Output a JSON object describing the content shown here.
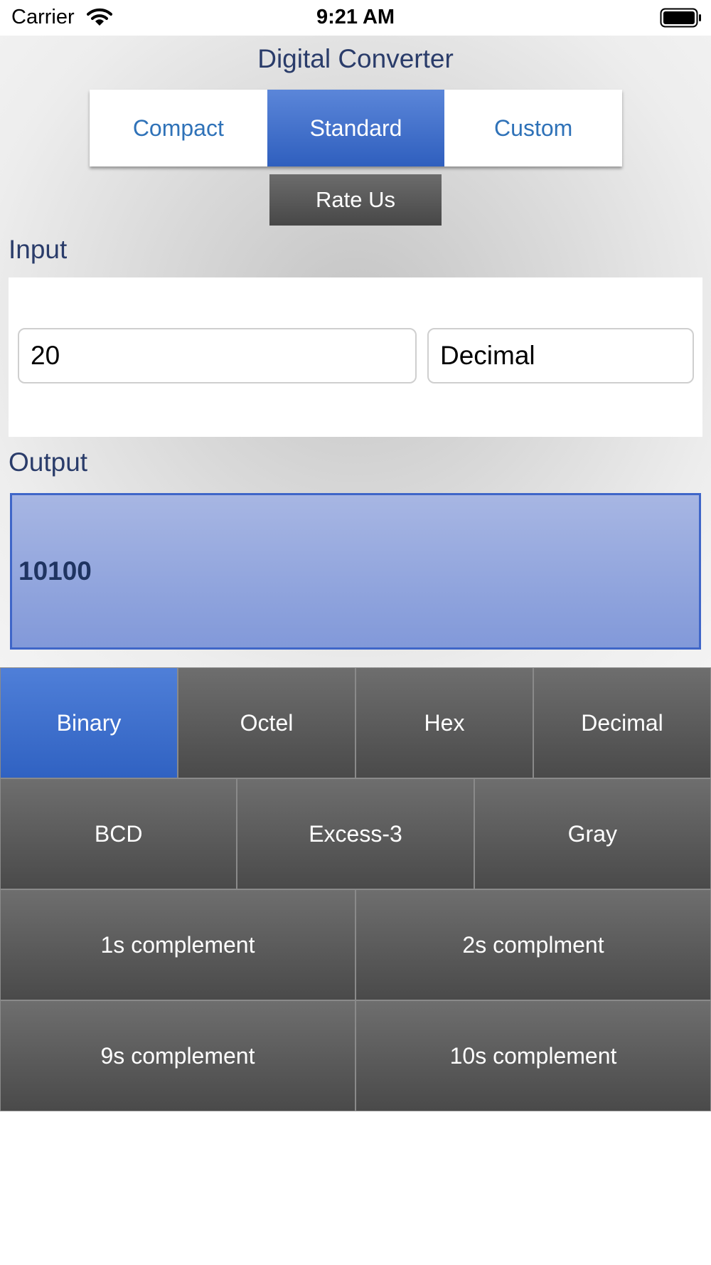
{
  "status_bar": {
    "carrier": "Carrier",
    "time": "9:21 AM",
    "icons": [
      "wifi-icon",
      "battery-icon"
    ]
  },
  "app": {
    "title": "Digital Converter",
    "mode_tabs": [
      {
        "label": "Compact",
        "active": false
      },
      {
        "label": "Standard",
        "active": true
      },
      {
        "label": "Custom",
        "active": false
      }
    ],
    "rate_label": "Rate Us"
  },
  "input": {
    "label": "Input",
    "value": "20",
    "base": "Decimal"
  },
  "output": {
    "label": "Output",
    "value": "10100"
  },
  "keypad": {
    "rows": [
      [
        "Binary",
        "Octel",
        "Hex",
        "Decimal"
      ],
      [
        "BCD",
        "Excess-3",
        "Gray"
      ],
      [
        "1s complement",
        "2s complment"
      ],
      [
        "9s complement",
        "10s complement"
      ]
    ],
    "active": "Binary"
  },
  "colors": {
    "accent": "#3f6ccb",
    "title_text": "#2a3c6a",
    "tab_text": "#2f72b8",
    "key_background": "#555555",
    "output_background": "#95a8de"
  }
}
